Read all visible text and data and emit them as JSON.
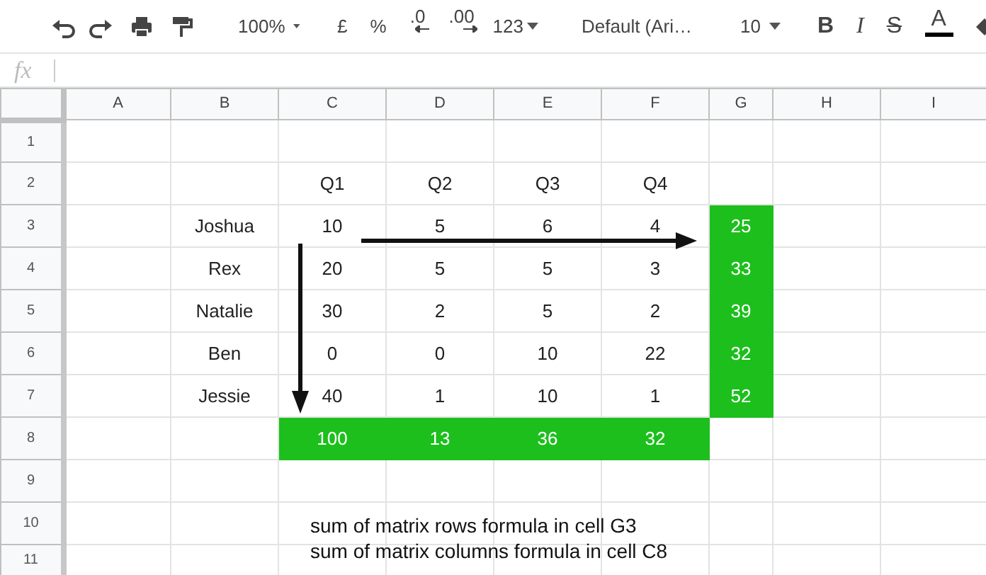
{
  "toolbar": [
    {
      "kind": "undo"
    },
    {
      "kind": "redo"
    },
    {
      "kind": "print"
    },
    {
      "kind": "paint"
    },
    {
      "kind": "separator"
    },
    {
      "kind": "dropdown",
      "text": "100%"
    },
    {
      "kind": "separator"
    },
    {
      "kind": "text",
      "text": "£"
    },
    {
      "kind": "text",
      "text": "%"
    },
    {
      "kind": "decrease",
      "text": ".0"
    },
    {
      "kind": "increase",
      "text": ".00"
    },
    {
      "kind": "menu",
      "text": "123"
    },
    {
      "kind": "separator"
    },
    {
      "kind": "font",
      "text": "Default (Ari…"
    },
    {
      "kind": "separator"
    },
    {
      "kind": "dropdown",
      "text": "10"
    },
    {
      "kind": "separator"
    },
    {
      "kind": "bold",
      "text": "B"
    },
    {
      "kind": "italic",
      "text": "I"
    },
    {
      "kind": "strike",
      "text": "S"
    },
    {
      "kind": "color",
      "text": "A"
    },
    {
      "kind": "fill"
    }
  ],
  "formula_bar": {
    "label": "fx"
  },
  "columns": [
    "A",
    "B",
    "C",
    "D",
    "E",
    "F",
    "G",
    "H",
    "I"
  ],
  "row_headers": [
    "1",
    "2",
    "3",
    "4",
    "5",
    "6",
    "7",
    "8",
    "9",
    "10",
    "11"
  ],
  "quarters": [
    "Q1",
    "Q2",
    "Q3",
    "Q4"
  ],
  "people": [
    {
      "name": "Joshua",
      "values": [
        "10",
        "5",
        "6",
        "4"
      ],
      "total": "25"
    },
    {
      "name": "Rex",
      "values": [
        "20",
        "5",
        "5",
        "3"
      ],
      "total": "33"
    },
    {
      "name": "Natalie",
      "values": [
        "30",
        "2",
        "5",
        "2"
      ],
      "total": "39"
    },
    {
      "name": "Ben",
      "values": [
        "0",
        "0",
        "10",
        "22"
      ],
      "total": "32"
    },
    {
      "name": "Jessie",
      "values": [
        "40",
        "1",
        "10",
        "1"
      ],
      "total": "52"
    }
  ],
  "column_totals": [
    "100",
    "13",
    "36",
    "32"
  ],
  "notes": [
    "sum of matrix rows formula in cell G3",
    "sum of matrix columns formula in cell C8"
  ]
}
